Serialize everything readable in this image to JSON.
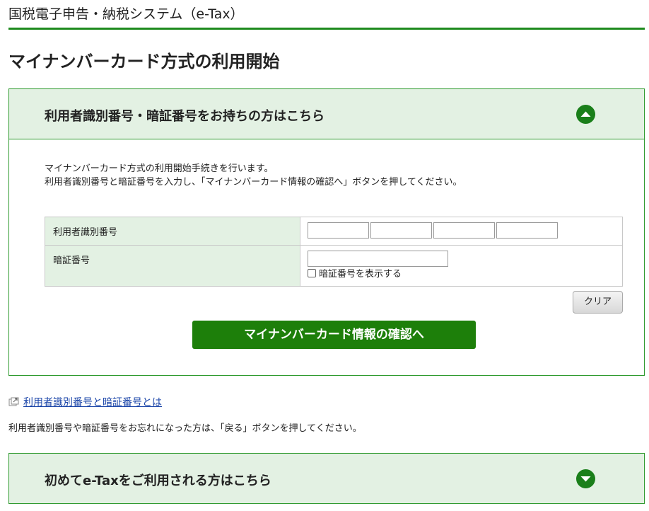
{
  "header": {
    "title": "国税電子申告・納税システム（e-Tax）"
  },
  "page": {
    "title": "マイナンバーカード方式の利用開始"
  },
  "panel1": {
    "heading": "利用者識別番号・暗証番号をお持ちの方はこちら",
    "intro_line1": "マイナンバーカード方式の利用開始手続きを行います。",
    "intro_line2": "利用者識別番号と暗証番号を入力し、「マイナンバーカード情報の確認へ」ボタンを押してください。",
    "form": {
      "user_id_label": "利用者識別番号",
      "user_id_values": [
        "",
        "",
        "",
        ""
      ],
      "password_label": "暗証番号",
      "password_value": "",
      "show_password_label": "暗証番号を表示する"
    },
    "clear_label": "クリア",
    "confirm_label": "マイナンバーカード情報の確認へ"
  },
  "help": {
    "link_text": "利用者識別番号と暗証番号とは",
    "note": "利用者識別番号や暗証番号をお忘れになった方は、「戻る」ボタンを押してください。"
  },
  "panel2": {
    "heading": "初めてe-Taxをご利用される方はこちら"
  },
  "icons": {
    "collapse": "chevron-up-circle-icon",
    "expand": "chevron-down-circle-icon",
    "external": "external-link-icon"
  },
  "colors": {
    "accent": "#1a7f1a",
    "panel_bg": "#e3f1e3",
    "button": "#1d7f0a",
    "link": "#1a44a8"
  }
}
